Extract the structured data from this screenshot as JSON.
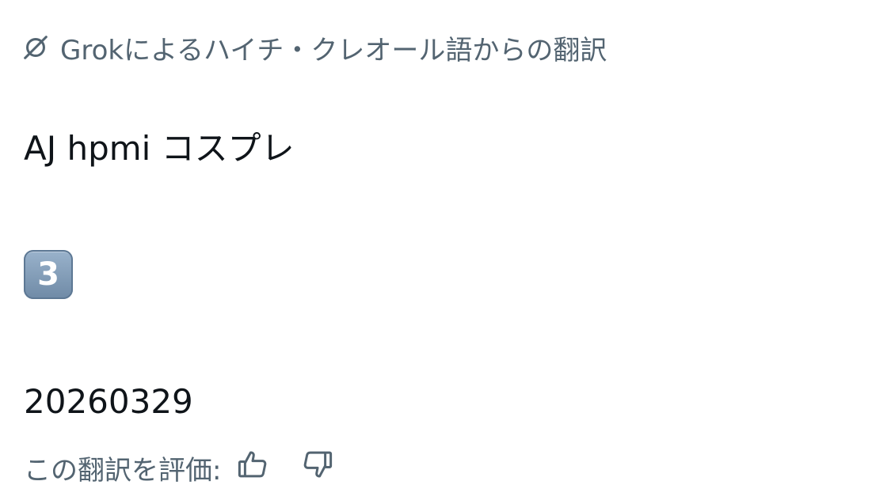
{
  "header": {
    "icon": "grok-icon",
    "text": "Grokによるハイチ・クレオール語からの翻訳"
  },
  "content": {
    "line1": "AJ hpmi コスプレ",
    "keycap_emoji": "3",
    "line3": "20260329"
  },
  "rating": {
    "label": "この翻訳を評価:",
    "thumbs_up_icon": "thumbs-up-icon",
    "thumbs_down_icon": "thumbs-down-icon"
  },
  "colors": {
    "primary_text": "#0f1419",
    "secondary_text": "#536471",
    "keycap": "#7f9bb8"
  }
}
